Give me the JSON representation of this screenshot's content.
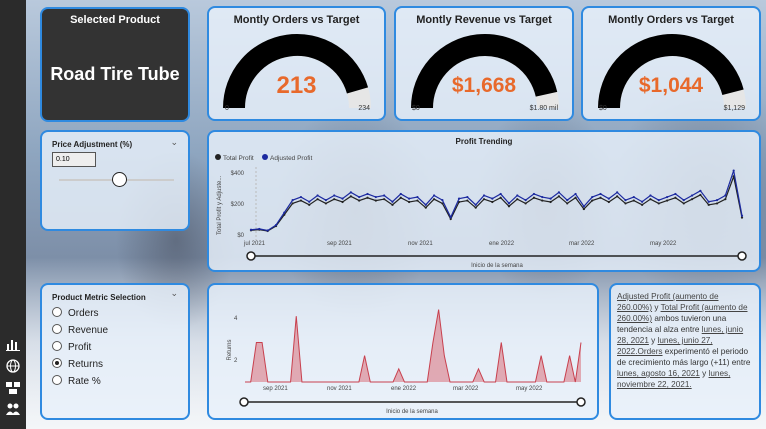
{
  "selected_product": {
    "title": "Selected Product",
    "value": "Road Tire Tube"
  },
  "gauges": [
    {
      "title": "Montly Orders vs Target",
      "value": "213",
      "min": "0",
      "max": "234",
      "fraction": 0.91
    },
    {
      "title": "Montly Revenue vs Target",
      "value": "$1,668",
      "min": "$0",
      "max": "$1.80 mil",
      "fraction": 0.93
    },
    {
      "title": "Montly Orders vs Target",
      "value": "$1,044",
      "min": "$0",
      "max": "$1,129",
      "fraction": 0.92
    }
  ],
  "price_adjustment": {
    "title": "Price Adjustment (%)",
    "value": "0.10",
    "slider_fraction": 0.52
  },
  "profit_trending": {
    "title": "Profit Trending",
    "legend": [
      "Total Profit",
      "Adjusted Profit"
    ],
    "ylabel": "Total Profit y Adjuste...",
    "xlabel": "Inicio de la semana",
    "yticks": [
      "$400",
      "$200",
      "$0"
    ],
    "xticks": [
      "jul 2021",
      "sep 2021",
      "nov 2021",
      "ene 2022",
      "mar 2022",
      "may 2022"
    ]
  },
  "metric_selection": {
    "title": "Product Metric Selection",
    "options": [
      "Orders",
      "Revenue",
      "Profit",
      "Returns",
      "Rate %"
    ],
    "selected": 3
  },
  "returns_chart": {
    "ylabel": "Returns",
    "xlabel": "Inicio de la semana",
    "yticks": [
      "4",
      "2"
    ],
    "xticks": [
      "sep 2021",
      "nov 2021",
      "ene 2022",
      "mar 2022",
      "may 2022"
    ]
  },
  "narrative": {
    "p1": "Adjusted Profit (aumento de 260.00%)",
    "p2": "y ",
    "p3": "Total Profit (aumento de 260.00%)",
    "p4": " ambos tuvieron una tendencia al alza entre ",
    "p5": "lunes, junio 28, 2021",
    "p6": " y ",
    "p7": "lunes, junio 27, 2022.",
    "p8": "Orders",
    "p9": " experimentó el periodo de crecimiento más largo (+11) entre ",
    "p10": "lunes, agosto 16, 2021",
    "p11": " y ",
    "p12": "lunes, noviembre 22, 2021."
  },
  "chart_data": [
    {
      "type": "line",
      "title": "Profit Trending",
      "series": [
        {
          "name": "Total Profit",
          "values": [
            40,
            45,
            35,
            70,
            150,
            230,
            250,
            220,
            260,
            230,
            260,
            240,
            280,
            250,
            270,
            250,
            260,
            220,
            270,
            240,
            250,
            200,
            260,
            230,
            120,
            240,
            250,
            200,
            260,
            240,
            270,
            210,
            260,
            230,
            270,
            250,
            240,
            280,
            230,
            270,
            190,
            250,
            270,
            240,
            280,
            230,
            250,
            220,
            260,
            230,
            250,
            270,
            230,
            260,
            290,
            220,
            230,
            260,
            420,
            130
          ]
        },
        {
          "name": "Adjusted Profit",
          "values": [
            44,
            50,
            39,
            77,
            165,
            253,
            275,
            242,
            286,
            253,
            286,
            264,
            308,
            275,
            297,
            275,
            286,
            242,
            297,
            264,
            275,
            220,
            286,
            253,
            132,
            264,
            275,
            220,
            286,
            264,
            297,
            231,
            286,
            253,
            297,
            275,
            264,
            308,
            253,
            297,
            209,
            275,
            297,
            264,
            308,
            253,
            275,
            242,
            286,
            253,
            275,
            297,
            253,
            286,
            319,
            242,
            253,
            286,
            462,
            143
          ]
        }
      ],
      "ylim": [
        0,
        480
      ]
    },
    {
      "type": "area",
      "ylabel": "Returns",
      "values": [
        0,
        0,
        3,
        3,
        0,
        0,
        0,
        0,
        0,
        5,
        0,
        0,
        0,
        0,
        0,
        0,
        0,
        0,
        0,
        0,
        0,
        2,
        0,
        0,
        0,
        0,
        0,
        1,
        0,
        0,
        0,
        0,
        0,
        3,
        5.5,
        2,
        0,
        0,
        0,
        0,
        0,
        1,
        0,
        0,
        0,
        3,
        0,
        0,
        0,
        0,
        0,
        0,
        2,
        0,
        0,
        0,
        0,
        2,
        0,
        3
      ],
      "ylim": [
        0,
        6
      ]
    }
  ]
}
